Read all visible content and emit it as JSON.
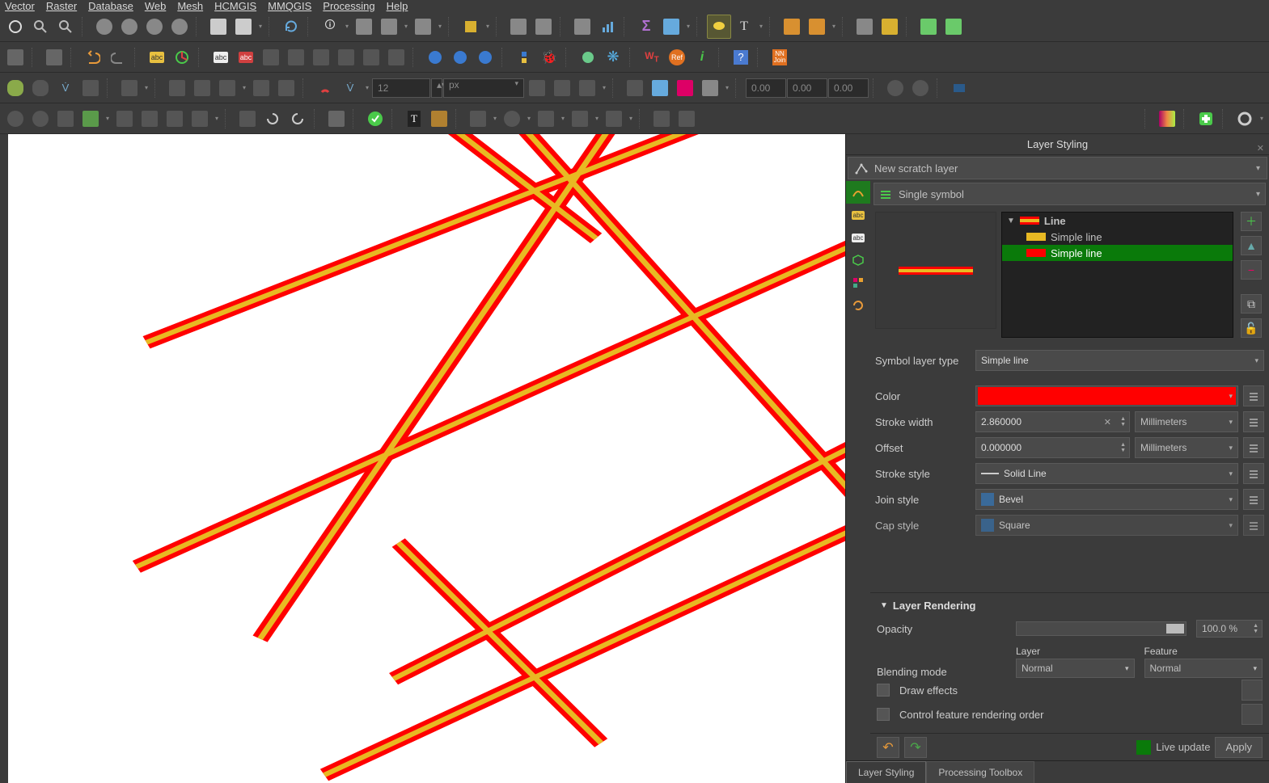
{
  "menus": [
    "Vector",
    "Raster",
    "Database",
    "Web",
    "Mesh",
    "HCMGIS",
    "MMQGIS",
    "Processing",
    "Help"
  ],
  "toolbar": {
    "spin_value": "12",
    "spin_unit": "px",
    "coord1": "0.00",
    "coord2": "0.00",
    "coord3": "0.00"
  },
  "panel": {
    "title": "Layer Styling",
    "layer_name": "New scratch layer",
    "symbol_type": "Single symbol",
    "tree": {
      "root": "Line",
      "children": [
        "Simple line",
        "Simple line"
      ],
      "selected": 1
    },
    "symbol_layer_type_label": "Symbol layer type",
    "symbol_layer_type": "Simple line",
    "props": {
      "color_label": "Color",
      "color": "#ff0000",
      "stroke_width_label": "Stroke width",
      "stroke_width": "2.860000",
      "stroke_width_unit": "Millimeters",
      "offset_label": "Offset",
      "offset": "0.000000",
      "offset_unit": "Millimeters",
      "stroke_style_label": "Stroke style",
      "stroke_style": "Solid Line",
      "join_style_label": "Join style",
      "join_style": "Bevel",
      "cap_style_label": "Cap style",
      "cap_style": "Square"
    },
    "rendering": {
      "header": "Layer Rendering",
      "opacity_label": "Opacity",
      "opacity_value": "100.0 %",
      "blending_label": "Blending mode",
      "layer_label": "Layer",
      "feature_label": "Feature",
      "layer_mode": "Normal",
      "feature_mode": "Normal",
      "draw_effects": "Draw effects",
      "control_order": "Control feature rendering order"
    },
    "live_update": "Live update",
    "apply": "Apply",
    "tabs": [
      "Layer Styling",
      "Processing Toolbox"
    ]
  }
}
